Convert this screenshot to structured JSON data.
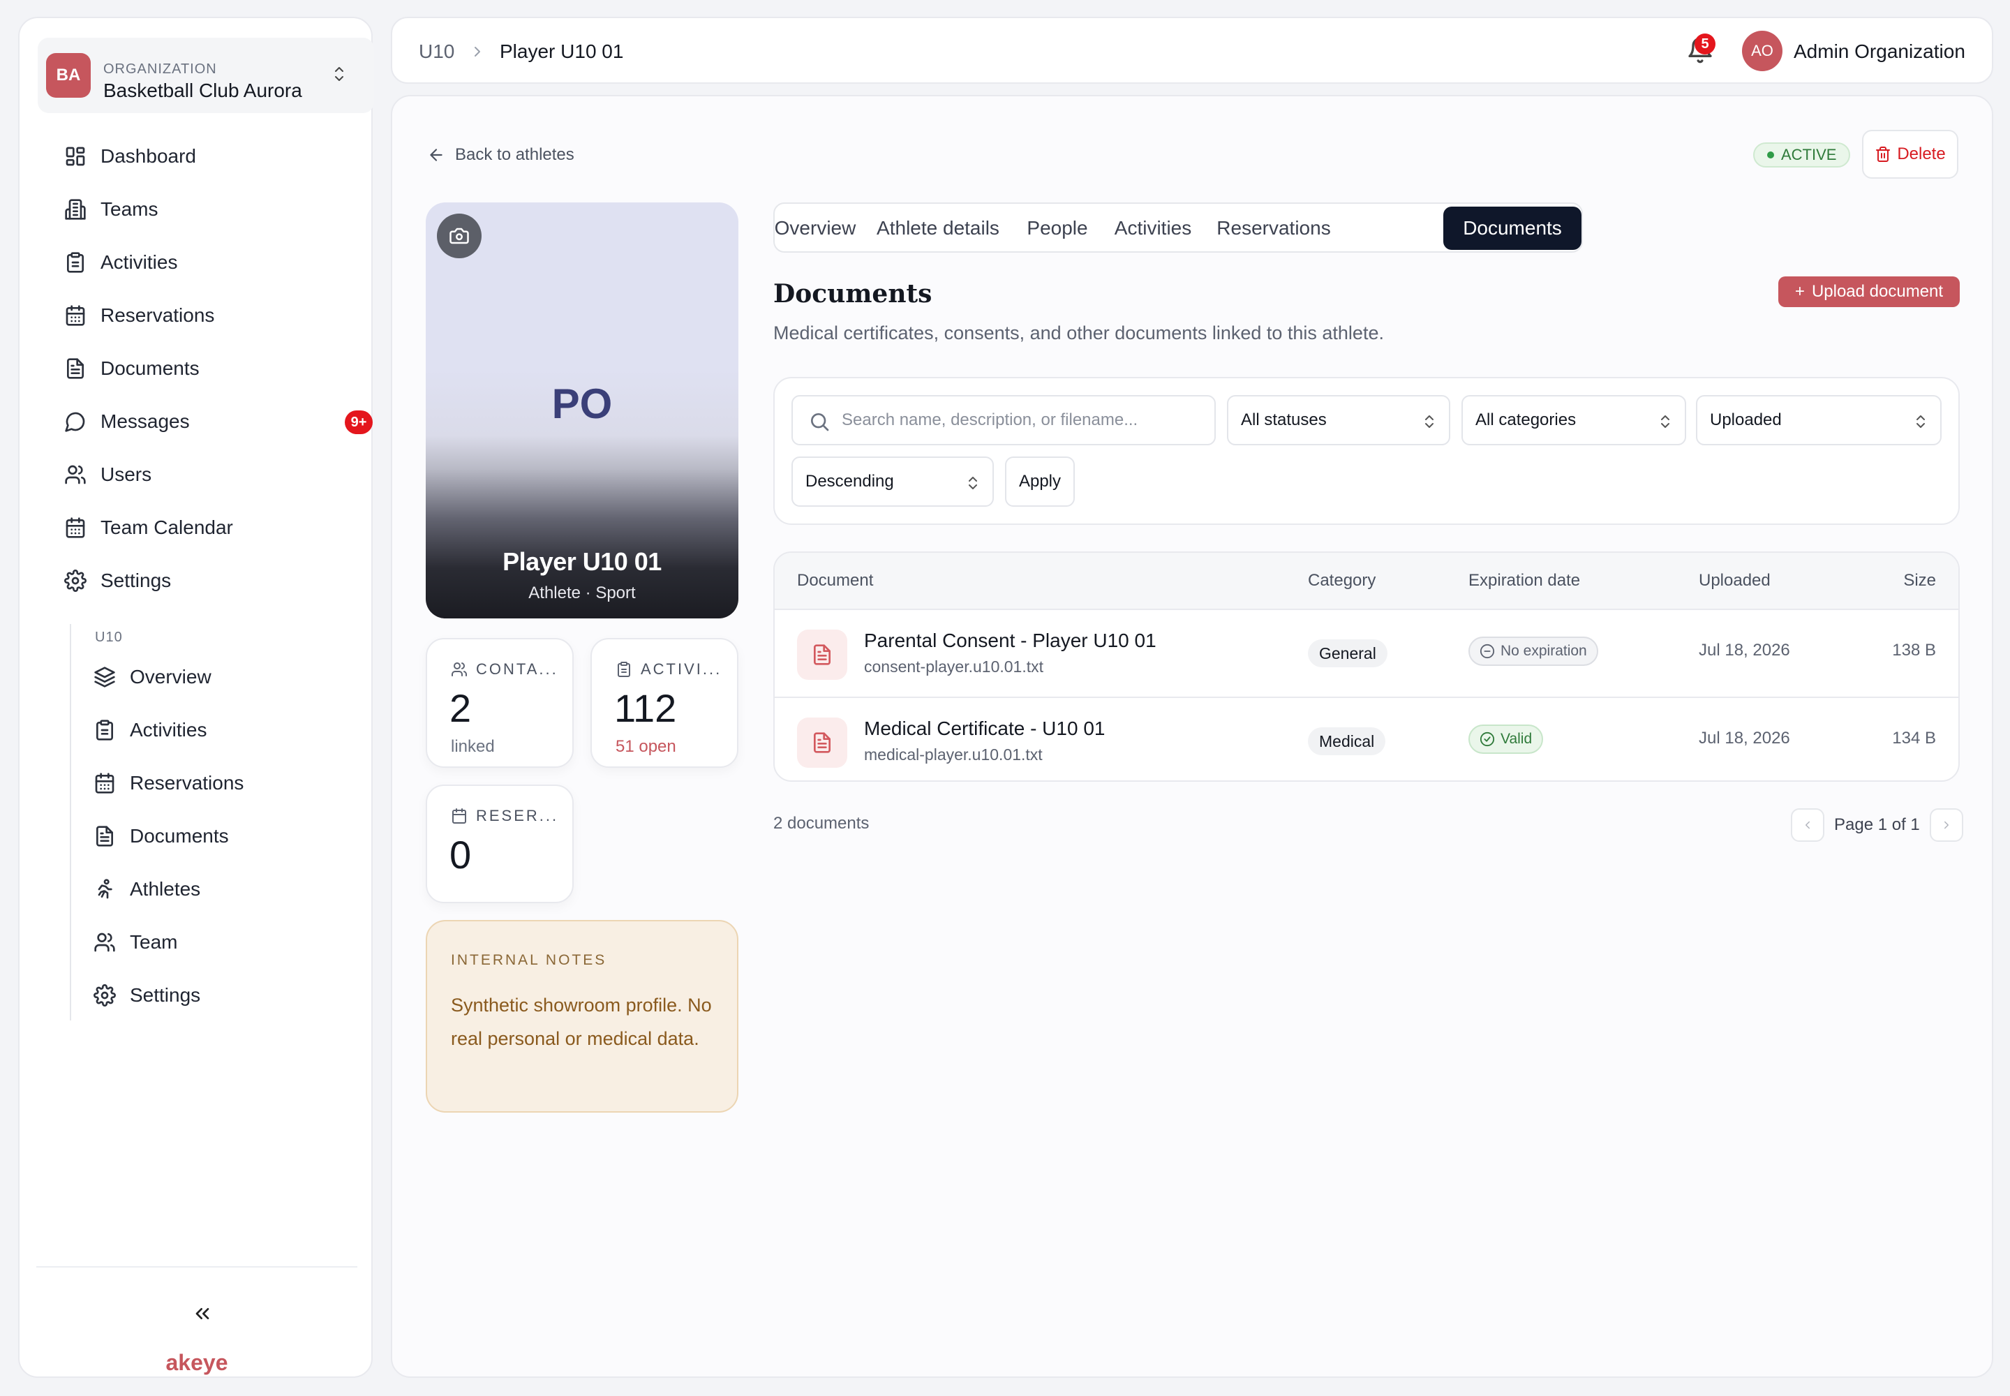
{
  "org": {
    "initials": "BA",
    "label": "ORGANIZATION",
    "name": "Basketball Club Aurora"
  },
  "nav": {
    "items": [
      {
        "label": "Dashboard",
        "icon": "dashboard-icon"
      },
      {
        "label": "Teams",
        "icon": "teams-icon"
      },
      {
        "label": "Activities",
        "icon": "clipboard-icon"
      },
      {
        "label": "Reservations",
        "icon": "calendar-icon"
      },
      {
        "label": "Documents",
        "icon": "document-icon"
      },
      {
        "label": "Messages",
        "icon": "message-icon",
        "badge": "9+"
      },
      {
        "label": "Users",
        "icon": "users-icon"
      },
      {
        "label": "Team Calendar",
        "icon": "calendar-icon"
      },
      {
        "label": "Settings",
        "icon": "gear-icon"
      }
    ],
    "team_label": "U10",
    "team_items": [
      {
        "label": "Overview",
        "icon": "layers-icon"
      },
      {
        "label": "Activities",
        "icon": "clipboard-icon"
      },
      {
        "label": "Reservations",
        "icon": "calendar-icon"
      },
      {
        "label": "Documents",
        "icon": "document-icon"
      },
      {
        "label": "Athletes",
        "icon": "runner-icon"
      },
      {
        "label": "Team",
        "icon": "users-icon"
      },
      {
        "label": "Settings",
        "icon": "gear-icon"
      }
    ],
    "collapse_glyph": "«",
    "brand": "akeye"
  },
  "topbar": {
    "breadcrumb": [
      "U10",
      "Player U10 01"
    ],
    "notifications_count": "5",
    "user_initials": "AO",
    "user_name": "Admin Organization"
  },
  "header": {
    "back_label": "Back to athletes",
    "status": "ACTIVE",
    "delete_label": "Delete"
  },
  "profile": {
    "initials": "PO",
    "name": "Player U10 01",
    "subtitle": "Athlete · Sport"
  },
  "stats": [
    {
      "label": "CONTA...",
      "value": "2",
      "sub": "linked",
      "icon": "users-icon"
    },
    {
      "label": "ACTIVI...",
      "value": "112",
      "sub": "51 open",
      "icon": "clipboard-icon"
    },
    {
      "label": "RESER...",
      "value": "0",
      "sub": "",
      "icon": "calendar-icon"
    }
  ],
  "notes": {
    "title": "INTERNAL NOTES",
    "body": "Synthetic showroom profile. No real personal or medical data."
  },
  "tabs": [
    "Overview",
    "Athlete details",
    "People",
    "Activities",
    "Reservations",
    "Documents"
  ],
  "active_tab": "Documents",
  "documents": {
    "title": "Documents",
    "description": "Medical certificates, consents, and other documents linked to this athlete.",
    "upload_label": "Upload document",
    "filters": {
      "search_placeholder": "Search name, description, or filename...",
      "status": "All statuses",
      "category": "All categories",
      "sort_field": "Uploaded",
      "sort_order": "Descending",
      "apply_label": "Apply"
    },
    "columns": [
      "Document",
      "Category",
      "Expiration date",
      "Uploaded",
      "Size"
    ],
    "rows": [
      {
        "name": "Parental Consent - Player U10 01",
        "file": "consent-player.u10.01.txt",
        "category": "General",
        "expiration": "No expiration",
        "expiration_state": "none",
        "uploaded": "Jul 18, 2026",
        "size": "138 B"
      },
      {
        "name": "Medical Certificate - U10 01",
        "file": "medical-player.u10.01.txt",
        "category": "Medical",
        "expiration": "Valid",
        "expiration_state": "valid",
        "uploaded": "Jul 18, 2026",
        "size": "134 B"
      }
    ],
    "count_label": "2 documents",
    "page_label": "Page 1 of 1"
  },
  "colors": {
    "brand": "#c6565d",
    "active_tab_bg": "#0f172a",
    "badge_red": "#e4161d",
    "success": "#2f7a3a"
  }
}
